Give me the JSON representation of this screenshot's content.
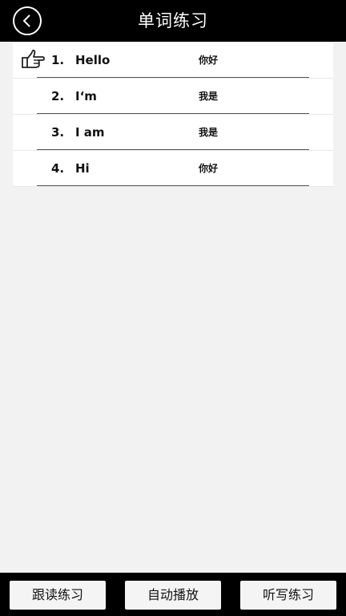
{
  "header": {
    "title": "单词练习",
    "back_icon": "chevron-left-icon"
  },
  "words": [
    {
      "num": "1.",
      "word": "Hello",
      "meaning": "你好",
      "active": true
    },
    {
      "num": "2.",
      "word": "I‘m",
      "meaning": "我是",
      "active": false
    },
    {
      "num": "3.",
      "word": "I am",
      "meaning": "我是",
      "active": false
    },
    {
      "num": "4.",
      "word": "Hi",
      "meaning": "你好",
      "active": false
    }
  ],
  "footer": {
    "follow_read": "跟读练习",
    "auto_play": "自动播放",
    "dictation": "听写练习"
  }
}
